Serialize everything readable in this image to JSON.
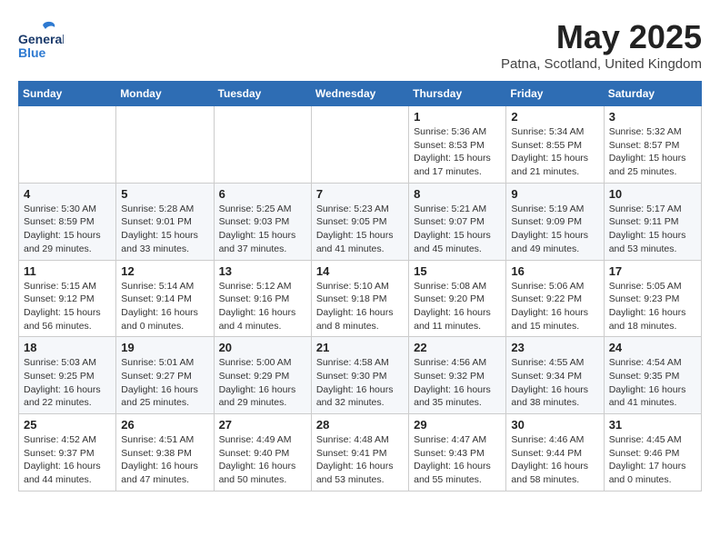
{
  "header": {
    "logo_general": "General",
    "logo_blue": "Blue",
    "month_title": "May 2025",
    "location": "Patna, Scotland, United Kingdom"
  },
  "weekdays": [
    "Sunday",
    "Monday",
    "Tuesday",
    "Wednesday",
    "Thursday",
    "Friday",
    "Saturday"
  ],
  "weeks": [
    [
      {
        "day": "",
        "info": ""
      },
      {
        "day": "",
        "info": ""
      },
      {
        "day": "",
        "info": ""
      },
      {
        "day": "",
        "info": ""
      },
      {
        "day": "1",
        "info": "Sunrise: 5:36 AM\nSunset: 8:53 PM\nDaylight: 15 hours\nand 17 minutes."
      },
      {
        "day": "2",
        "info": "Sunrise: 5:34 AM\nSunset: 8:55 PM\nDaylight: 15 hours\nand 21 minutes."
      },
      {
        "day": "3",
        "info": "Sunrise: 5:32 AM\nSunset: 8:57 PM\nDaylight: 15 hours\nand 25 minutes."
      }
    ],
    [
      {
        "day": "4",
        "info": "Sunrise: 5:30 AM\nSunset: 8:59 PM\nDaylight: 15 hours\nand 29 minutes."
      },
      {
        "day": "5",
        "info": "Sunrise: 5:28 AM\nSunset: 9:01 PM\nDaylight: 15 hours\nand 33 minutes."
      },
      {
        "day": "6",
        "info": "Sunrise: 5:25 AM\nSunset: 9:03 PM\nDaylight: 15 hours\nand 37 minutes."
      },
      {
        "day": "7",
        "info": "Sunrise: 5:23 AM\nSunset: 9:05 PM\nDaylight: 15 hours\nand 41 minutes."
      },
      {
        "day": "8",
        "info": "Sunrise: 5:21 AM\nSunset: 9:07 PM\nDaylight: 15 hours\nand 45 minutes."
      },
      {
        "day": "9",
        "info": "Sunrise: 5:19 AM\nSunset: 9:09 PM\nDaylight: 15 hours\nand 49 minutes."
      },
      {
        "day": "10",
        "info": "Sunrise: 5:17 AM\nSunset: 9:11 PM\nDaylight: 15 hours\nand 53 minutes."
      }
    ],
    [
      {
        "day": "11",
        "info": "Sunrise: 5:15 AM\nSunset: 9:12 PM\nDaylight: 15 hours\nand 56 minutes."
      },
      {
        "day": "12",
        "info": "Sunrise: 5:14 AM\nSunset: 9:14 PM\nDaylight: 16 hours\nand 0 minutes."
      },
      {
        "day": "13",
        "info": "Sunrise: 5:12 AM\nSunset: 9:16 PM\nDaylight: 16 hours\nand 4 minutes."
      },
      {
        "day": "14",
        "info": "Sunrise: 5:10 AM\nSunset: 9:18 PM\nDaylight: 16 hours\nand 8 minutes."
      },
      {
        "day": "15",
        "info": "Sunrise: 5:08 AM\nSunset: 9:20 PM\nDaylight: 16 hours\nand 11 minutes."
      },
      {
        "day": "16",
        "info": "Sunrise: 5:06 AM\nSunset: 9:22 PM\nDaylight: 16 hours\nand 15 minutes."
      },
      {
        "day": "17",
        "info": "Sunrise: 5:05 AM\nSunset: 9:23 PM\nDaylight: 16 hours\nand 18 minutes."
      }
    ],
    [
      {
        "day": "18",
        "info": "Sunrise: 5:03 AM\nSunset: 9:25 PM\nDaylight: 16 hours\nand 22 minutes."
      },
      {
        "day": "19",
        "info": "Sunrise: 5:01 AM\nSunset: 9:27 PM\nDaylight: 16 hours\nand 25 minutes."
      },
      {
        "day": "20",
        "info": "Sunrise: 5:00 AM\nSunset: 9:29 PM\nDaylight: 16 hours\nand 29 minutes."
      },
      {
        "day": "21",
        "info": "Sunrise: 4:58 AM\nSunset: 9:30 PM\nDaylight: 16 hours\nand 32 minutes."
      },
      {
        "day": "22",
        "info": "Sunrise: 4:56 AM\nSunset: 9:32 PM\nDaylight: 16 hours\nand 35 minutes."
      },
      {
        "day": "23",
        "info": "Sunrise: 4:55 AM\nSunset: 9:34 PM\nDaylight: 16 hours\nand 38 minutes."
      },
      {
        "day": "24",
        "info": "Sunrise: 4:54 AM\nSunset: 9:35 PM\nDaylight: 16 hours\nand 41 minutes."
      }
    ],
    [
      {
        "day": "25",
        "info": "Sunrise: 4:52 AM\nSunset: 9:37 PM\nDaylight: 16 hours\nand 44 minutes."
      },
      {
        "day": "26",
        "info": "Sunrise: 4:51 AM\nSunset: 9:38 PM\nDaylight: 16 hours\nand 47 minutes."
      },
      {
        "day": "27",
        "info": "Sunrise: 4:49 AM\nSunset: 9:40 PM\nDaylight: 16 hours\nand 50 minutes."
      },
      {
        "day": "28",
        "info": "Sunrise: 4:48 AM\nSunset: 9:41 PM\nDaylight: 16 hours\nand 53 minutes."
      },
      {
        "day": "29",
        "info": "Sunrise: 4:47 AM\nSunset: 9:43 PM\nDaylight: 16 hours\nand 55 minutes."
      },
      {
        "day": "30",
        "info": "Sunrise: 4:46 AM\nSunset: 9:44 PM\nDaylight: 16 hours\nand 58 minutes."
      },
      {
        "day": "31",
        "info": "Sunrise: 4:45 AM\nSunset: 9:46 PM\nDaylight: 17 hours\nand 0 minutes."
      }
    ]
  ]
}
